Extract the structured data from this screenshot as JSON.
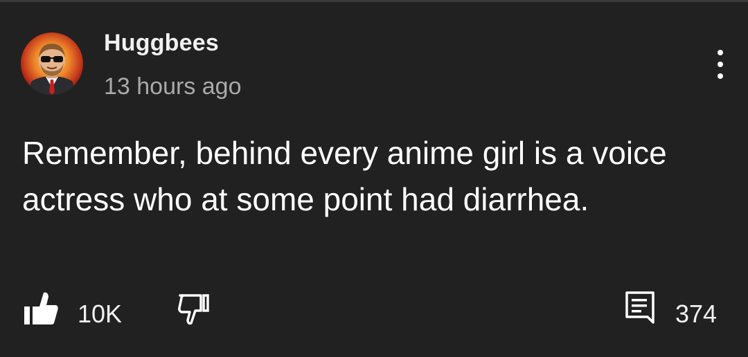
{
  "comment": {
    "author": "Huggbees",
    "timestamp": "13 hours ago",
    "text": "Remember, behind every anime girl is a voice actress who at some point had diarrhea.",
    "avatar_icon": "user-avatar",
    "menu_icon": "more-vert-icon"
  },
  "actions": {
    "like_icon": "thumbs-up-icon",
    "like_count": "10K",
    "dislike_icon": "thumbs-down-icon",
    "reply_icon": "comment-icon",
    "reply_count": "374"
  },
  "colors": {
    "background": "#212121",
    "primary_text": "#ffffff",
    "secondary_text": "#aaaaaa"
  }
}
